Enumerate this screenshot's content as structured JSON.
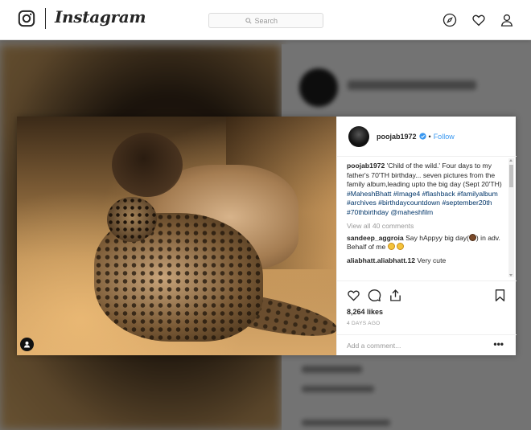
{
  "nav": {
    "wordmark": "Instagram",
    "search_placeholder": "Search"
  },
  "post": {
    "username": "poojab1972",
    "follow_label": "Follow",
    "separator": "•",
    "caption_user": "poojab1972",
    "caption_text": " 'Child of the wild.' Four days to my father's 70'TH birthday... seven pictures from the family album,leading upto the big day (Sept 20'TH) ",
    "hashtags": [
      "#MaheshBhatt",
      "#Image4",
      "#flashback",
      "#familyalbum",
      "#archives",
      "#birthdaycountdown",
      "#september20th",
      "#70thbirthday",
      "@maheshfilm"
    ],
    "view_all_comments": "View all 40 comments",
    "comments": [
      {
        "user": "sandeep_aggroia",
        "text": " Say hAppyy big day(",
        "text_after_emoji": ") in adv. Behalf of me "
      },
      {
        "user": "aliabhatt.aliabhatt.12",
        "text": " Very cute"
      }
    ],
    "likes": "8,264 likes",
    "time": "4 DAYS AGO",
    "comment_placeholder": "Add a comment...",
    "more_label": "•••"
  },
  "colors": {
    "link": "#3897f0",
    "hashtag": "#003569",
    "text": "#262626",
    "muted": "#999999"
  },
  "icons": [
    "instagram-glyph-icon",
    "search-icon",
    "explore-compass-icon",
    "heart-icon",
    "profile-icon",
    "verified-badge-icon",
    "like-heart-icon",
    "comment-bubble-icon",
    "share-icon",
    "bookmark-icon",
    "user-tag-icon"
  ]
}
